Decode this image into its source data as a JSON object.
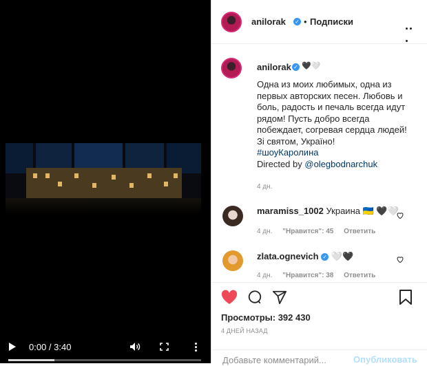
{
  "video": {
    "time": "0:00 / 3:40",
    "progress_fraction": 0.24
  },
  "header": {
    "username": "anilorak",
    "separator": "•",
    "follow_label": "Подписки"
  },
  "post": {
    "username": "anilorak",
    "hearts": "🖤🤍",
    "caption_lines": [
      "Одна из моих любимых, одна из",
      "первых авторских песен. Любовь и",
      "боль, радость и печаль всегда идут",
      "рядом! Пусть добро всегда",
      "побеждает, согревая сердца людей!",
      "Зі святом, Україно!"
    ],
    "hashtag": "#шоуКаролина",
    "directed_prefix": "Directed by ",
    "directed_mention": "@olegbodnarchuk",
    "time_ago": "4 дн."
  },
  "comments": [
    {
      "user": "maramiss_1002",
      "text": "Украина 🇺🇦 🖤🤍",
      "time": "4 дн.",
      "likes": "\"Нравится\": 45",
      "reply": "Ответить"
    },
    {
      "user": "zlata.ognevich",
      "text": "🤍🖤",
      "time": "4 дн.",
      "likes": "\"Нравится\": 38",
      "reply": "Ответить"
    }
  ],
  "stats": {
    "views_label": "Просмотры: 392 430",
    "date": "4 ДНЕЙ НАЗАД"
  },
  "add_comment": {
    "placeholder": "Добавьте комментарий...",
    "publish_label": "Опубликовать"
  },
  "colors": {
    "like_red": "#ed4956",
    "link_blue": "#00376b",
    "verified_blue": "#3897f0",
    "publish_disabled": "#b2dffc"
  }
}
